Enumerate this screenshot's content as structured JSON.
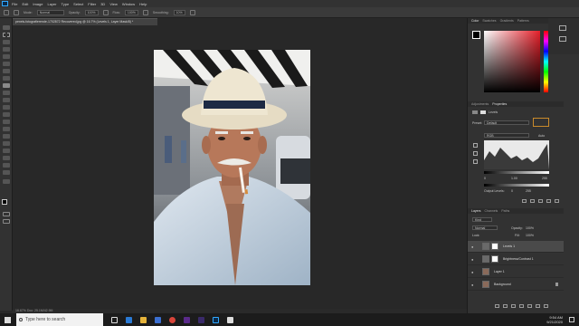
{
  "menu": [
    "File",
    "Edit",
    "Image",
    "Layer",
    "Type",
    "Select",
    "Filter",
    "3D",
    "View",
    "Window",
    "Help"
  ],
  "options": {
    "mode_label": "Mode:",
    "mode_value": "Normal",
    "opacity_label": "Opacity:",
    "opacity_value": "100%",
    "flow_label": "Flow:",
    "flow_value": "100%",
    "smoothing_label": "Smoothing:",
    "smoothing_value": "10%"
  },
  "document_tab": "pexels-fotografierende-1702872 Recovered.jpg @ 16.7% (Levels 1, Layer Mask/8) *",
  "status": "16.67%   Doc: 25.1M/42.9M",
  "color_panel": {
    "tabs": [
      "Color",
      "Swatches",
      "Gradients",
      "Patterns"
    ]
  },
  "properties_panel": {
    "tabs": [
      "Adjustments",
      "Properties"
    ],
    "title": "Levels",
    "preset_label": "Preset:",
    "preset_value": "Default",
    "channel_value": "RGB",
    "auto_label": "Auto",
    "input_values": [
      "0",
      "1.00",
      "255"
    ],
    "output_label": "Output Levels:",
    "output_values": [
      "0",
      "255"
    ]
  },
  "layers_panel": {
    "tabs": [
      "Layers",
      "Channels",
      "Paths"
    ],
    "kind_label": "Kind",
    "blend_value": "Normal",
    "opacity_label": "Opacity:",
    "opacity_value": "100%",
    "lock_label": "Lock:",
    "fill_label": "Fill:",
    "fill_value": "100%",
    "layers": [
      {
        "name": "Levels 1"
      },
      {
        "name": "Brightness/Contrast 1"
      },
      {
        "name": "Layer 1"
      },
      {
        "name": "Background"
      }
    ]
  },
  "taskbar": {
    "search_placeholder": "Type here to search",
    "time": "9:54 AM",
    "date": "9/21/2020"
  }
}
